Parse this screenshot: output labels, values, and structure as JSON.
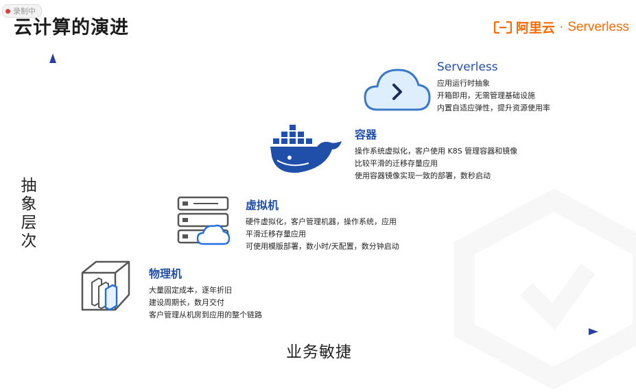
{
  "recording_badge": "录制中",
  "title": "云计算的演进",
  "brand": {
    "name_cn": "阿里云",
    "separator": "·",
    "name_en": "Serverless",
    "color": "#ff6a00"
  },
  "axes": {
    "y_label": "抽象层次",
    "x_label": "业务敏捷",
    "arrow_color": "#2b3f9e",
    "start_color": "#7fe0d6"
  },
  "stages": [
    {
      "key": "physical",
      "icon": "server-rack-icon",
      "title": "物理机",
      "lines": [
        "大量固定成本，逐年折旧",
        "建设周期长，数月交付",
        "客户管理从机房到应用的整个链路"
      ]
    },
    {
      "key": "vm",
      "icon": "server-cloud-icon",
      "title": "虚拟机",
      "lines": [
        "硬件虚拟化，客户管理机器，操作系统，应用",
        "平滑迁移存量应用",
        "可使用模版部署，数小时/天配置，数分钟启动"
      ]
    },
    {
      "key": "container",
      "icon": "docker-whale-icon",
      "title": "容器",
      "lines": [
        "操作系统虚拟化，客户使用 K8S 管理容器和镜像",
        "比较平滑的迁移存量应用",
        "使用容器镜像实现一致的部署，数秒启动"
      ]
    },
    {
      "key": "serverless",
      "icon": "cloud-code-icon",
      "title": "Serverless",
      "lines": [
        "应用运行时抽象",
        "开箱即用，无需管理基础设施",
        "内置自适应弹性，提升资源使用率"
      ]
    }
  ]
}
